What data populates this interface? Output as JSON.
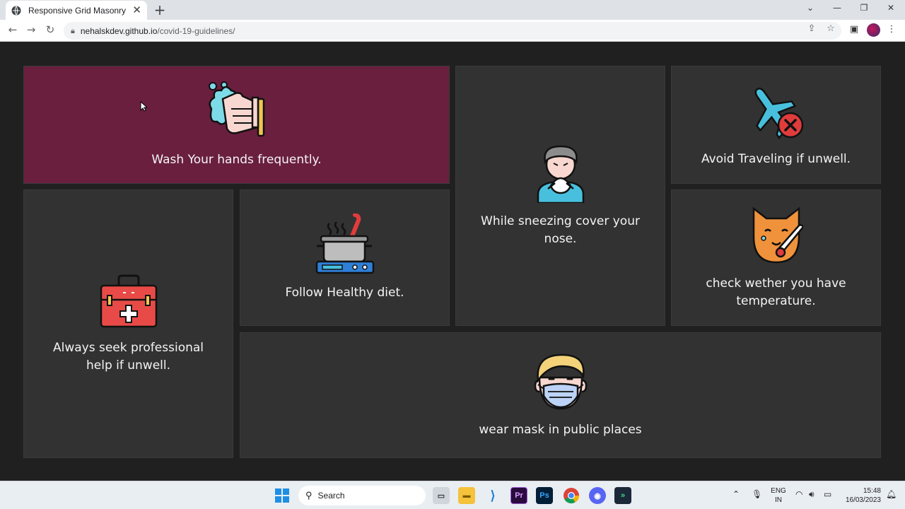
{
  "browser": {
    "tab_title": "Responsive Grid Masonry",
    "tab_close": "✕",
    "new_tab": "+",
    "url_domain": "nehalskdev.github.io",
    "url_path": "/covid-19-guidelines/"
  },
  "cards": [
    {
      "label": "Wash Your hands frequently.",
      "icon": "hand-wash-icon"
    },
    {
      "label": "While sneezing cover your nose.",
      "icon": "sneezing-person-icon"
    },
    {
      "label": "Avoid Traveling if unwell.",
      "icon": "no-travel-icon"
    },
    {
      "label": "Always seek professional help if unwell.",
      "icon": "first-aid-kit-icon"
    },
    {
      "label": "Follow Healthy diet.",
      "icon": "cooking-pot-icon"
    },
    {
      "label": "check wether you have temperature.",
      "icon": "thermometer-cat-icon"
    },
    {
      "label": "wear mask in public places",
      "icon": "face-mask-icon"
    }
  ],
  "taskbar": {
    "search_label": "Search",
    "language": "ENG",
    "region": "IN",
    "time": "15:48",
    "date": "16/03/2023"
  },
  "colors": {
    "page_background": "#202020",
    "card_background": "#323232",
    "active_card_background": "#6a1f3f"
  }
}
